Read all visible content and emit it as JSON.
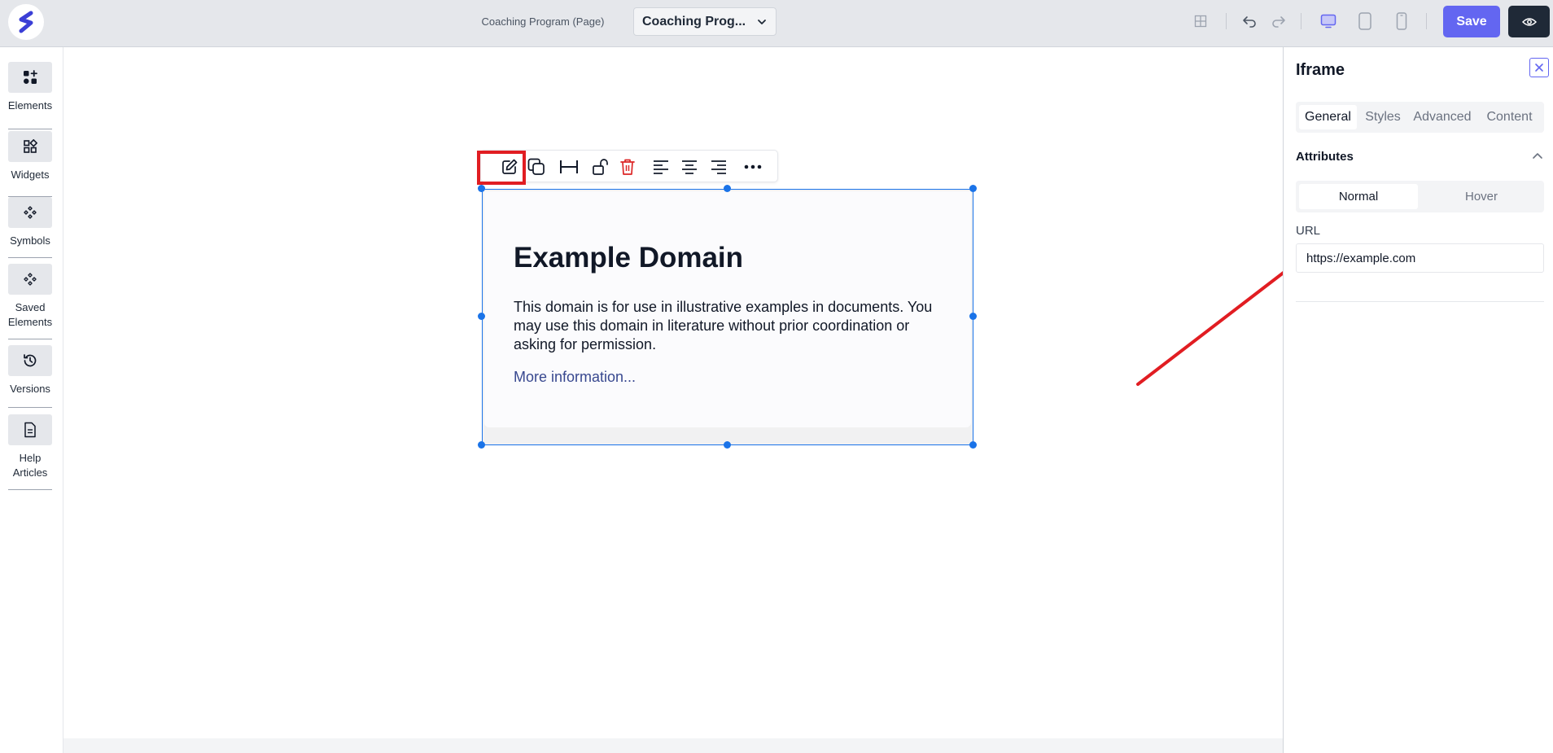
{
  "topbar": {
    "page_label": "Coaching Program (Page)",
    "page_select_value": "Coaching Prog...",
    "save_label": "Save",
    "icons": [
      "grid-icon",
      "undo-icon",
      "redo-icon",
      "desktop-icon",
      "tablet-icon",
      "mobile-icon",
      "eye-icon"
    ]
  },
  "sidebar": {
    "items": [
      {
        "label": "Elements",
        "icon": "elements-icon"
      },
      {
        "label": "Widgets",
        "icon": "widgets-icon"
      },
      {
        "label": "Symbols",
        "icon": "symbols-icon"
      },
      {
        "label": "Saved Elements",
        "icon": "saved-elements-icon"
      },
      {
        "label": "Versions",
        "icon": "history-icon"
      },
      {
        "label": "Help Articles",
        "icon": "document-icon"
      }
    ]
  },
  "toolbar": {
    "buttons": [
      "edit-icon",
      "duplicate-icon",
      "full-width-icon",
      "unlock-icon",
      "delete-icon",
      "align-left-icon",
      "align-center-icon",
      "align-right-icon",
      "more-icon"
    ]
  },
  "iframe": {
    "title": "Example Domain",
    "body": "This domain is for use in illustrative examples in documents. You may use this domain in literature without prior coordination or asking for permission.",
    "link": "More information..."
  },
  "panel": {
    "title": "Iframe",
    "tabs": [
      "General",
      "Styles",
      "Advanced",
      "Content"
    ],
    "active_tab": "General",
    "section_title": "Attributes",
    "state_tabs": [
      "Normal",
      "Hover"
    ],
    "url_label": "URL",
    "url_value": "https://example.com"
  },
  "colors": {
    "accent": "#6366f1",
    "selection": "#1a73e8",
    "highlight": "#e11d22",
    "delete": "#dc2626"
  }
}
